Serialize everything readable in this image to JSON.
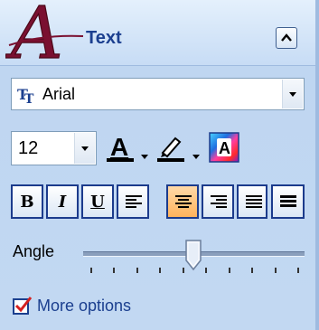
{
  "panel": {
    "title": "Text",
    "logo_letter": "A",
    "collapse_icon": "chevron-up-icon"
  },
  "font": {
    "selected": "Arial",
    "icon": "font-tt-icon"
  },
  "size": {
    "selected": "12"
  },
  "toolbar": {
    "text_color_glyph": "A",
    "text_color": "#000000",
    "highlight_color": "#000000",
    "effects_glyph": "A"
  },
  "format_buttons": {
    "bold": "B",
    "italic": "I",
    "underline": "U",
    "active": "align-center"
  },
  "angle": {
    "label": "Angle",
    "value_fraction": 0.5,
    "tick_count": 10
  },
  "more_options": {
    "label": "More options",
    "checked": true
  },
  "colors": {
    "accent": "#1b3f8f",
    "logo": "#7a1030",
    "active_button": "#ffb35c"
  }
}
